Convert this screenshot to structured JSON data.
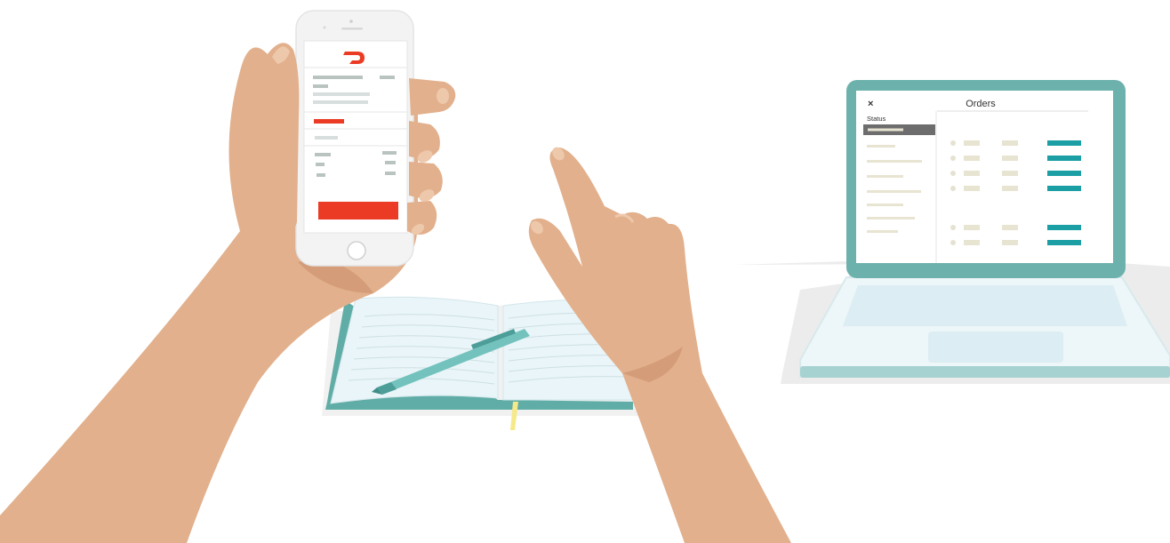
{
  "laptop": {
    "window_title": "Orders",
    "close_label": "×",
    "sidebar_heading": "Status",
    "order_rows": 6
  },
  "colors": {
    "skin": "#e2b08c",
    "skin_shadow": "#d49c79",
    "laptop_frame": "#6db1ad",
    "laptop_body": "#edf6f8",
    "laptop_panel": "#dcedf3",
    "accent_teal": "#1c9fa4",
    "brand_red": "#eb3b24",
    "notebook_page": "#e9f5f8",
    "notebook_cover": "#5fada6",
    "pen": "#74c2bd",
    "bookmark": "#f6e98a"
  },
  "icons": {
    "brand_logo": "doordash-logo-icon",
    "close": "close-icon",
    "home_button": "home-button-icon"
  }
}
